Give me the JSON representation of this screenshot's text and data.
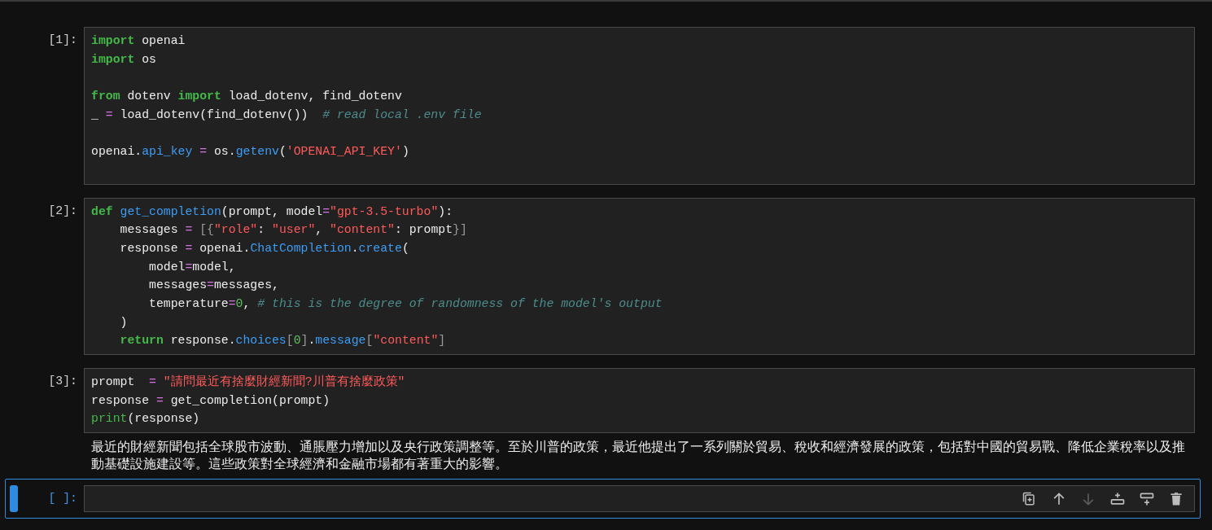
{
  "cells": [
    {
      "prompt": "[1]:",
      "selected": false,
      "lines": [
        {
          "kind": "code",
          "tokens": [
            {
              "kind": "kw",
              "text": "import"
            },
            {
              "kind": "plain",
              "text": " openai"
            }
          ]
        },
        {
          "kind": "code",
          "tokens": [
            {
              "kind": "kw",
              "text": "import"
            },
            {
              "kind": "plain",
              "text": " os"
            }
          ]
        },
        {
          "kind": "blank"
        },
        {
          "kind": "code",
          "tokens": [
            {
              "kind": "kw",
              "text": "from"
            },
            {
              "kind": "plain",
              "text": " dotenv "
            },
            {
              "kind": "kw",
              "text": "import"
            },
            {
              "kind": "plain",
              "text": " load_dotenv, find_dotenv"
            }
          ]
        },
        {
          "kind": "code",
          "tokens": [
            {
              "kind": "plain",
              "text": "_ "
            },
            {
              "kind": "op",
              "text": "="
            },
            {
              "kind": "plain",
              "text": " load_dotenv(find_dotenv())  "
            },
            {
              "kind": "comment",
              "text": "# read local .env file"
            }
          ]
        },
        {
          "kind": "blank"
        },
        {
          "kind": "code",
          "tokens": [
            {
              "kind": "plain",
              "text": "openai."
            },
            {
              "kind": "attr",
              "text": "api_key"
            },
            {
              "kind": "op",
              "text": " = "
            },
            {
              "kind": "plain",
              "text": "os."
            },
            {
              "kind": "attr",
              "text": "getenv"
            },
            {
              "kind": "plain",
              "text": "("
            },
            {
              "kind": "str",
              "text": "'OPENAI_API_KEY'"
            },
            {
              "kind": "plain",
              "text": ")"
            }
          ]
        },
        {
          "kind": "blank"
        }
      ]
    },
    {
      "prompt": "[2]:",
      "selected": false,
      "lines": [
        {
          "kind": "code",
          "tokens": [
            {
              "kind": "kw",
              "text": "def"
            },
            {
              "kind": "attr",
              "text": " get_completion"
            },
            {
              "kind": "plain",
              "text": "(prompt, model"
            },
            {
              "kind": "op",
              "text": "="
            },
            {
              "kind": "str",
              "text": "\"gpt-3.5-turbo\""
            },
            {
              "kind": "plain",
              "text": "):"
            }
          ]
        },
        {
          "kind": "code",
          "tokens": [
            {
              "kind": "plain",
              "text": "    messages "
            },
            {
              "kind": "op",
              "text": "="
            },
            {
              "kind": "punct",
              "text": " [{"
            },
            {
              "kind": "str",
              "text": "\"role\""
            },
            {
              "kind": "plain",
              "text": ": "
            },
            {
              "kind": "str",
              "text": "\"user\""
            },
            {
              "kind": "plain",
              "text": ", "
            },
            {
              "kind": "str",
              "text": "\"content\""
            },
            {
              "kind": "plain",
              "text": ": prompt"
            },
            {
              "kind": "punct",
              "text": "}]"
            }
          ]
        },
        {
          "kind": "code",
          "tokens": [
            {
              "kind": "plain",
              "text": "    response "
            },
            {
              "kind": "op",
              "text": "="
            },
            {
              "kind": "plain",
              "text": " openai."
            },
            {
              "kind": "attr",
              "text": "ChatCompletion"
            },
            {
              "kind": "plain",
              "text": "."
            },
            {
              "kind": "attr",
              "text": "create"
            },
            {
              "kind": "plain",
              "text": "("
            }
          ]
        },
        {
          "kind": "code",
          "tokens": [
            {
              "kind": "plain",
              "text": "        model"
            },
            {
              "kind": "op",
              "text": "="
            },
            {
              "kind": "plain",
              "text": "model,"
            }
          ]
        },
        {
          "kind": "code",
          "tokens": [
            {
              "kind": "plain",
              "text": "        messages"
            },
            {
              "kind": "op",
              "text": "="
            },
            {
              "kind": "plain",
              "text": "messages,"
            }
          ]
        },
        {
          "kind": "code",
          "tokens": [
            {
              "kind": "plain",
              "text": "        temperature"
            },
            {
              "kind": "op",
              "text": "="
            },
            {
              "kind": "num",
              "text": "0"
            },
            {
              "kind": "plain",
              "text": ", "
            },
            {
              "kind": "comment",
              "text": "# this is the degree of randomness of the model's output"
            }
          ]
        },
        {
          "kind": "code",
          "tokens": [
            {
              "kind": "plain",
              "text": "    )"
            }
          ]
        },
        {
          "kind": "code",
          "tokens": [
            {
              "kind": "kw",
              "text": "    return"
            },
            {
              "kind": "plain",
              "text": " response."
            },
            {
              "kind": "attr",
              "text": "choices"
            },
            {
              "kind": "punct",
              "text": "["
            },
            {
              "kind": "num",
              "text": "0"
            },
            {
              "kind": "punct",
              "text": "]"
            },
            {
              "kind": "plain",
              "text": "."
            },
            {
              "kind": "attr",
              "text": "message"
            },
            {
              "kind": "punct",
              "text": "["
            },
            {
              "kind": "str",
              "text": "\"content\""
            },
            {
              "kind": "punct",
              "text": "]"
            }
          ]
        }
      ]
    },
    {
      "prompt": "[3]:",
      "selected": false,
      "lines": [
        {
          "kind": "code",
          "tokens": [
            {
              "kind": "plain",
              "text": "prompt  "
            },
            {
              "kind": "op",
              "text": "="
            },
            {
              "kind": "str",
              "text": " \"請問最近有捨麼財經新聞?川普有捨麼政策\""
            }
          ]
        },
        {
          "kind": "code",
          "tokens": [
            {
              "kind": "plain",
              "text": "response "
            },
            {
              "kind": "op",
              "text": "="
            },
            {
              "kind": "plain",
              "text": " get_completion(prompt)"
            }
          ]
        },
        {
          "kind": "code",
          "tokens": [
            {
              "kind": "builtin",
              "text": "print"
            },
            {
              "kind": "plain",
              "text": "(response)"
            }
          ]
        }
      ],
      "output": "最近的財經新聞包括全球股市波動、通脹壓力增加以及央行政策調整等。至於川普的政策，最近他提出了一系列關於貿易、稅收和經濟發展的政策，包括對中國的貿易戰、降低企業稅率以及推動基礎設施建設等。這些政策對全球經濟和金融市場都有著重大的影響。"
    },
    {
      "prompt": "[ ]:",
      "selected": true,
      "toolbar": [
        {
          "kind": "duplicate",
          "disabled": false
        },
        {
          "kind": "up",
          "disabled": false
        },
        {
          "kind": "down",
          "disabled": true
        },
        {
          "kind": "insert_above",
          "disabled": false
        },
        {
          "kind": "insert_below",
          "disabled": false
        },
        {
          "kind": "delete",
          "disabled": false
        }
      ]
    }
  ]
}
